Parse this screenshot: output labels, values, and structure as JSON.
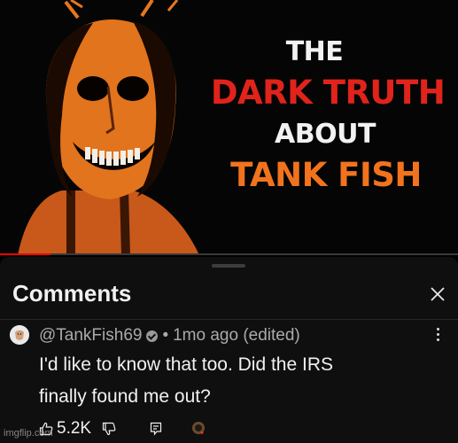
{
  "video": {
    "thumbnail_lines": [
      "THE",
      "DARK TRUTH",
      "ABOUT",
      "TANK FISH"
    ],
    "colors": {
      "white": "#f2f2f2",
      "red": "#e0231b",
      "orange": "#f2731d"
    },
    "progress_fraction": 0.11
  },
  "comments_panel": {
    "title": "Comments",
    "close_icon": "close-icon",
    "comment": {
      "author": "@TankFish69",
      "separator": "•",
      "time": "1mo ago (edited)",
      "text_line1": "I'd like to know that too. Did the IRS",
      "text_line2": "finally found me out?",
      "like_count": "5.2K",
      "icons": [
        "thumbs-up-icon",
        "thumbs-down-icon",
        "reply-icon",
        "creator-heart-icon",
        "more-vert-icon"
      ]
    }
  },
  "watermark": "imgflip.com"
}
